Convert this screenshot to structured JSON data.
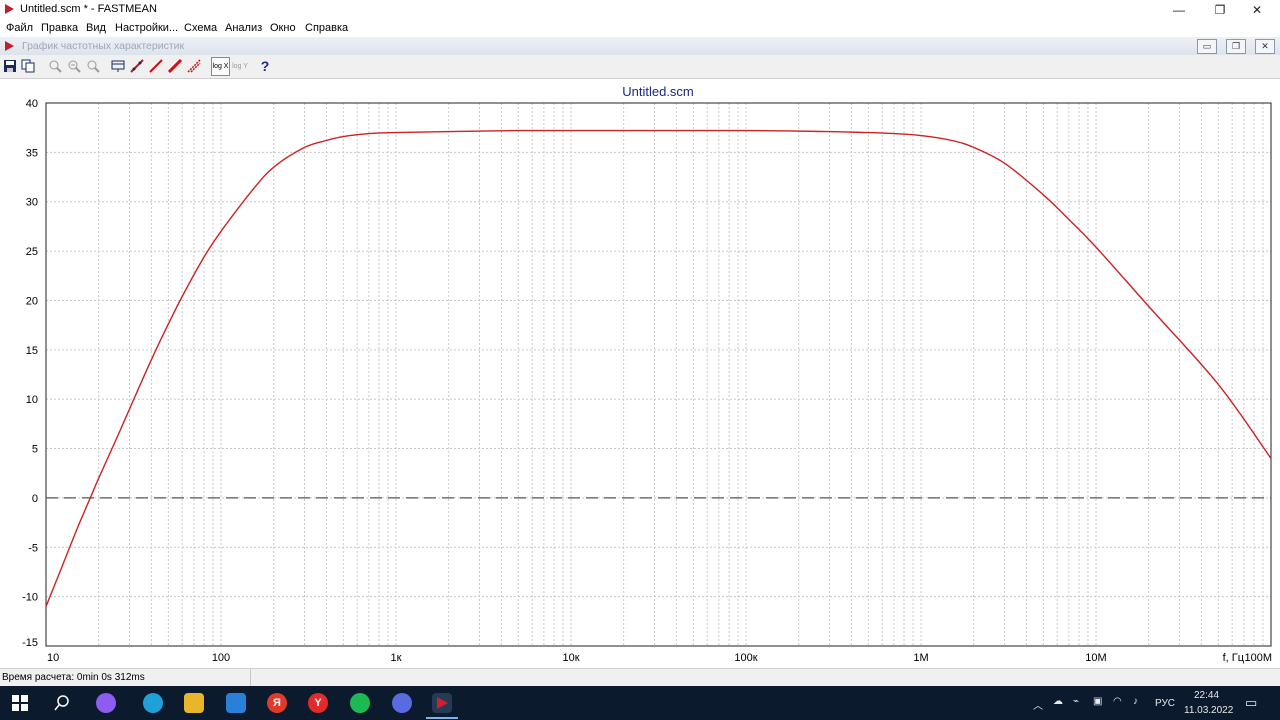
{
  "window": {
    "title": "Untitled.scm * - FASTMEAN",
    "controls": {
      "minimize": "—",
      "maximize": "❐",
      "close": "✕"
    }
  },
  "menu": [
    "Файл",
    "Правка",
    "Вид",
    "Настройки...",
    "Схема",
    "Анализ",
    "Окно",
    "Справка"
  ],
  "child_window": {
    "title": "График частотных характеристик"
  },
  "toolbar": {
    "logx_label": "log X",
    "logy_label": "log Y",
    "help_label": "?"
  },
  "chart_data": {
    "type": "line",
    "title": "Untitled.scm",
    "xlabel": "f, Гц",
    "ylabel": "",
    "xscale": "log",
    "xlim": [
      10,
      100000000
    ],
    "ylim": [
      -15,
      40
    ],
    "grid": true,
    "x_tick_labels": [
      "10",
      "100",
      "1к",
      "10к",
      "100к",
      "1M",
      "10M",
      "100M"
    ],
    "y_ticks": [
      40,
      35,
      30,
      25,
      20,
      15,
      10,
      5,
      0,
      -5,
      -10,
      -15
    ],
    "reference_line": {
      "y": 0,
      "style": "dashed",
      "color": "#555555"
    },
    "series": [
      {
        "color": "#cc2222",
        "x": [
          10,
          12,
          15,
          18,
          20,
          25,
          30,
          40,
          50,
          60,
          80,
          100,
          150,
          200,
          300,
          400,
          500,
          700,
          1000,
          2000,
          5000,
          10000,
          100000,
          300000,
          500000,
          700000,
          1000000,
          1500000,
          2000000,
          3000000,
          5000000,
          7000000,
          10000000,
          20000000,
          50000000,
          100000000
        ],
        "y": [
          -11,
          -7.5,
          -3.2,
          0.1,
          2.0,
          5.8,
          9.0,
          14.0,
          17.6,
          20.4,
          24.4,
          27.0,
          31.1,
          33.5,
          35.5,
          36.2,
          36.6,
          36.9,
          37.0,
          37.1,
          37.2,
          37.2,
          37.2,
          37.1,
          37.0,
          36.9,
          36.7,
          36.2,
          35.5,
          33.9,
          30.7,
          28.2,
          25.4,
          19.4,
          11.5,
          4.0
        ]
      }
    ]
  },
  "status": {
    "text": "Время расчета: 0min 0s 312ms"
  },
  "taskbar": {
    "language": "РУС",
    "time": "22:44",
    "date": "11.03.2022"
  }
}
